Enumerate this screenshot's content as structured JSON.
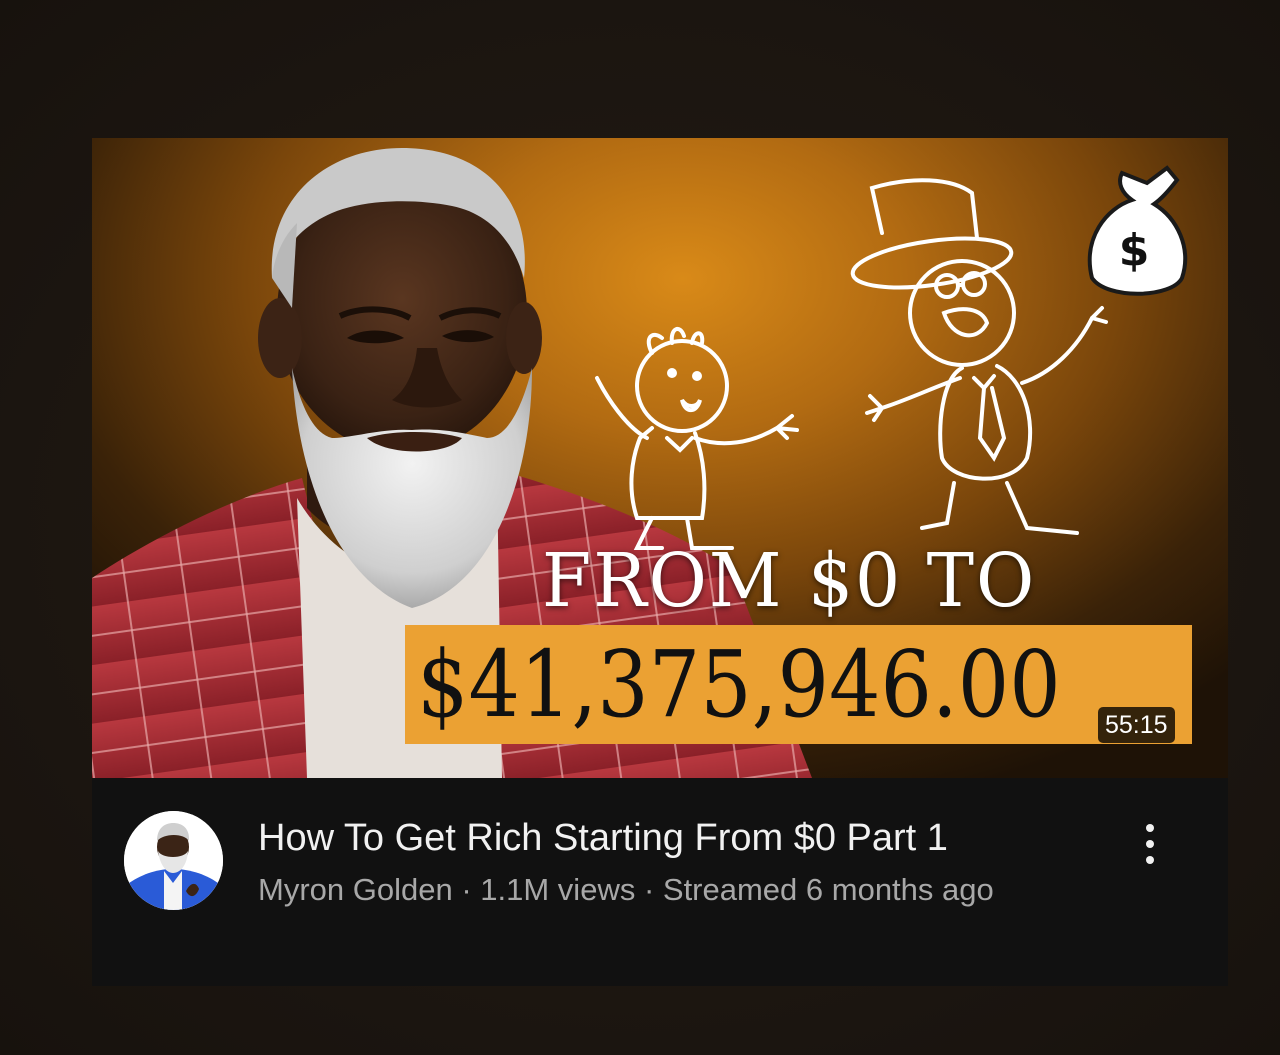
{
  "thumbnail": {
    "headline_top": "FROM $0 TO",
    "amount": "$41,375,946.00",
    "duration": "55:15",
    "money_bag_symbol": "$",
    "colors": {
      "background_glow": "#d98a18",
      "amount_box": "#eba133",
      "jacket": "#b0323a"
    }
  },
  "video": {
    "title": "How To Get Rich Starting From $0 Part 1",
    "channel": "Myron Golden",
    "separator": " · ",
    "views": "1.1M views",
    "streamed": "Streamed 6 months ago"
  },
  "icons": {
    "menu": "more-vert-icon",
    "avatar": "channel-avatar"
  }
}
